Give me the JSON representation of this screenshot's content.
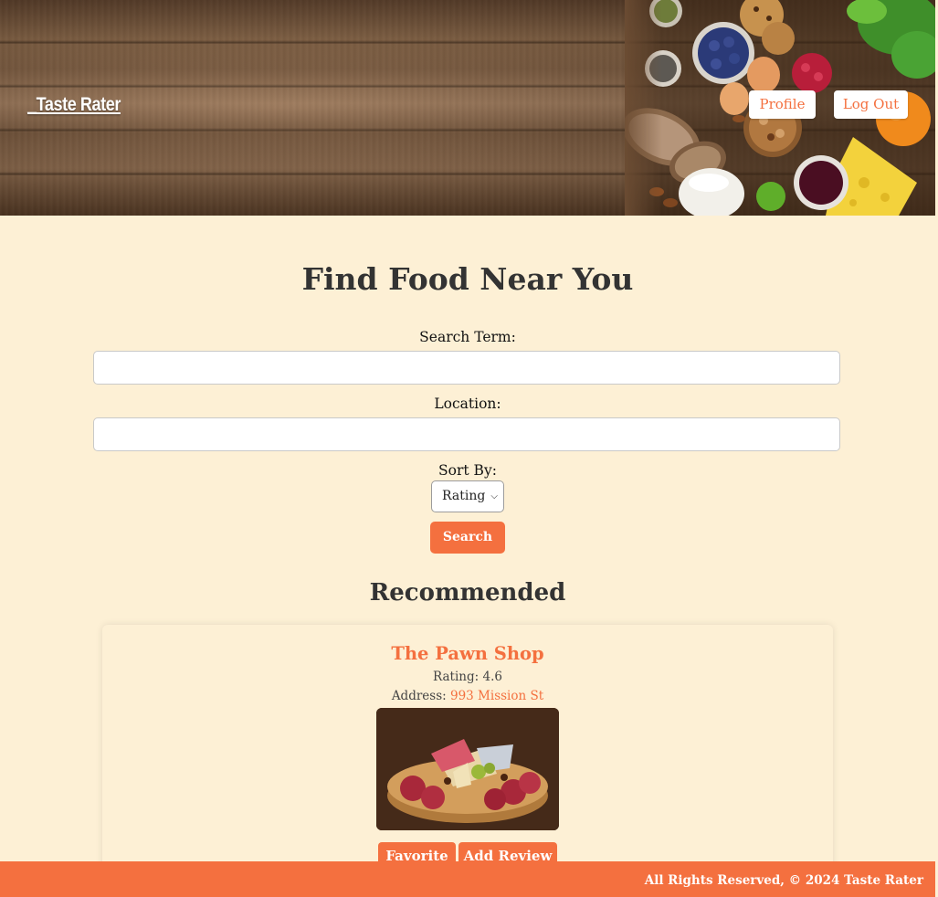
{
  "header": {
    "brand": "_Taste Rater",
    "nav": {
      "profile_label": "Profile",
      "logout_label": "Log Out"
    }
  },
  "search": {
    "title": "Find Food Near You",
    "term_label": "Search Term:",
    "term_value": "",
    "location_label": "Location:",
    "location_value": "",
    "sort_label": "Sort By:",
    "sort_selected": "Rating",
    "submit_label": "Search"
  },
  "recommended": {
    "title": "Recommended",
    "items": [
      {
        "name": "The Pawn Shop",
        "rating_label": "Rating:",
        "rating": "4.6",
        "address_label": "Address:",
        "address": "993 Mission St",
        "image": "charcuterie-board-photo",
        "favorite_label": "Favorite",
        "review_label": "Add Review"
      }
    ]
  },
  "footer": {
    "text": "All Rights Reserved, © 2024 Taste Rater"
  },
  "colors": {
    "accent": "#f4703f",
    "background": "#fdf0d5",
    "heading": "#333333",
    "white": "#ffffff"
  }
}
